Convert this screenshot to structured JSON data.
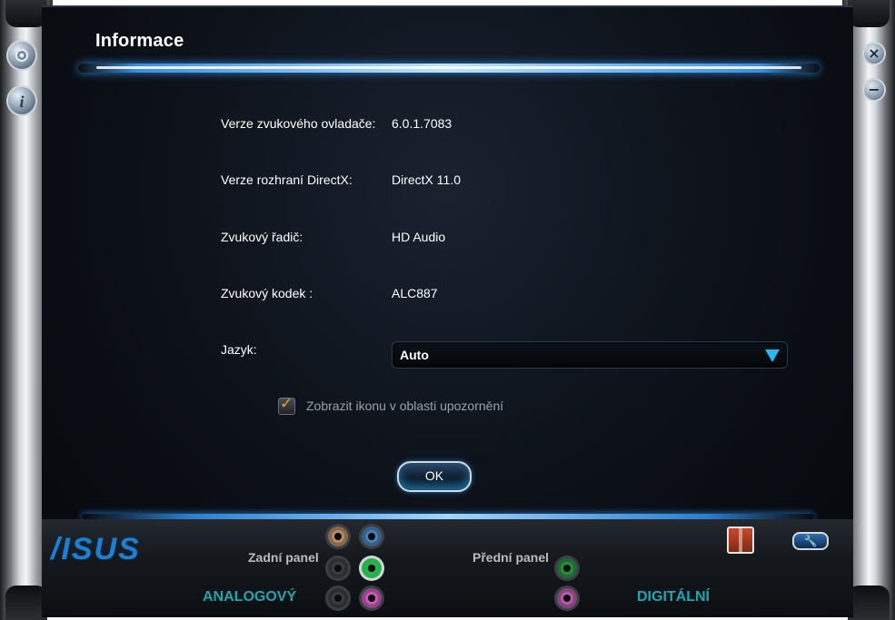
{
  "window": {
    "title": "Informace"
  },
  "info": {
    "driver_label": "Verze zvukového ovladače:",
    "driver_value": "6.0.1.7083",
    "directx_label": "Verze rozhraní DirectX:",
    "directx_value": "DirectX 11.0",
    "controller_label": "Zvukový řadič:",
    "controller_value": "HD Audio",
    "codec_label": "Zvukový kodek :",
    "codec_value": "ALC887",
    "language_label": "Jazyk:",
    "language_value": "Auto",
    "tray_checkbox_label": "Zobrazit ikonu v oblasti upozornění",
    "tray_checkbox_checked": true
  },
  "buttons": {
    "ok": "OK"
  },
  "bottom": {
    "brand": "/ISUS",
    "rear_panel": "Zadní panel",
    "front_panel": "Přední panel",
    "analog": "ANALOGOVÝ",
    "digital": "DIGITÁLNÍ"
  },
  "icons": {
    "settings": "gear-icon",
    "info": "info-icon",
    "close": "close-icon",
    "minimize": "minimize-icon",
    "spdif": "spdif-icon",
    "wrench": "wrench-icon"
  },
  "colors": {
    "accent_blue": "#29b8f0",
    "analog_digital_text": "#1ea7b0",
    "checkbox_mark": "#f0a020"
  }
}
